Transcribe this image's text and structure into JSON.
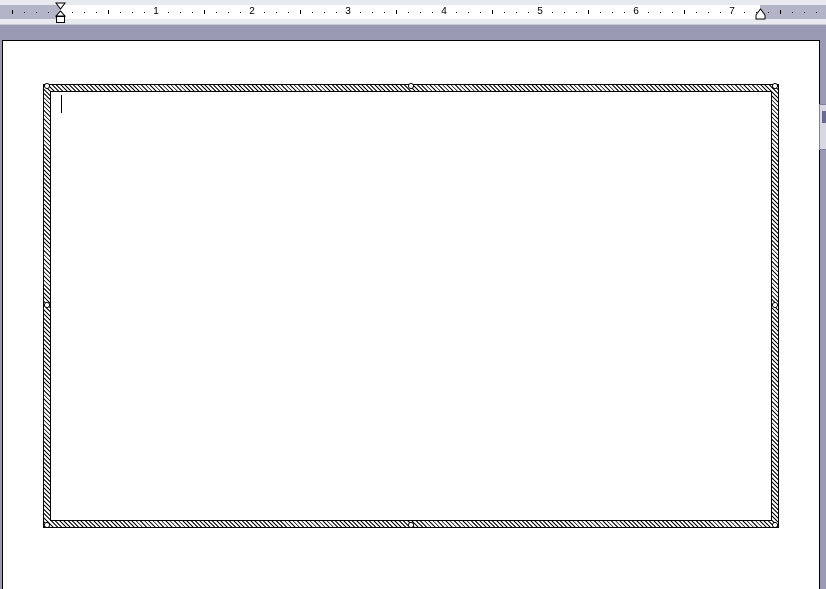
{
  "ruler": {
    "numbers": [
      "1",
      "2",
      "3",
      "4",
      "5",
      "6",
      "7"
    ]
  },
  "document": {
    "textbox_content": ""
  },
  "colors": {
    "workspace": "#9a9ab4",
    "ruler_margin": "#b4b4c8",
    "page": "#ffffff"
  }
}
